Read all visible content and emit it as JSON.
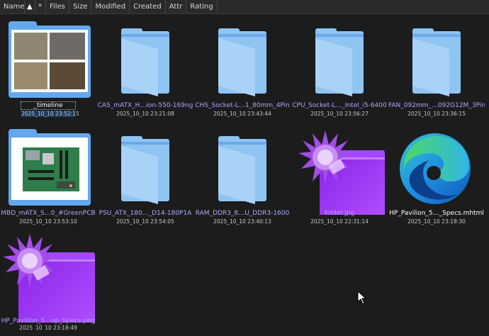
{
  "header": {
    "columns": [
      "Name",
      "▲",
      "*",
      "Files",
      "Size",
      "Modified",
      "Created",
      "Attr",
      "Rating"
    ]
  },
  "items": [
    {
      "name": "_timeline",
      "date": "2025_10_10 23:52:15",
      "kind": "image-folder",
      "selected": true
    },
    {
      "name": "CAS_mATX_H…ion-550-169ng",
      "date": "2025_10_10 23:21:08",
      "kind": "folder"
    },
    {
      "name": "CHS_Socket-L…1_80mm_4Pin",
      "date": "2025_10_10 23:43:44",
      "kind": "folder"
    },
    {
      "name": "CPU_Socket-L…_Intel_i5-6400",
      "date": "2025_10_10 23:56:27",
      "kind": "folder"
    },
    {
      "name": "FAN_092mm_…092G12M_3Pin",
      "date": "2025_10_10 23:36:15",
      "kind": "folder"
    },
    {
      "name": "MBD_mATX_S…0_#GreenPCB",
      "date": "2025_10_10 23:53:10",
      "kind": "board-folder"
    },
    {
      "name": "PSU_ATX_180…_D14-180P1A",
      "date": "2025_10_10 23:54:05",
      "kind": "folder"
    },
    {
      "name": "RAM_DDR3_8…U_DDR3-1600",
      "date": "2025_10_10 23:40:13",
      "kind": "folder"
    },
    {
      "name": "folder.jpg",
      "date": "2025_10_10 22:31:14",
      "kind": "purple-image"
    },
    {
      "name": "HP_Pavilion_5…_Specs.mhtml",
      "date": "2025_10_10 23:18:30",
      "kind": "edge-file"
    },
    {
      "name": "HP_Pavilion_5…op_Specs.png",
      "date": "2025_10_10 23:18:49",
      "kind": "purple-image"
    }
  ],
  "colors": {
    "folder": "#8fc4f3",
    "link_text": "#a9a9ff",
    "purple": "#a347ff",
    "background": "#1c1c1c"
  }
}
